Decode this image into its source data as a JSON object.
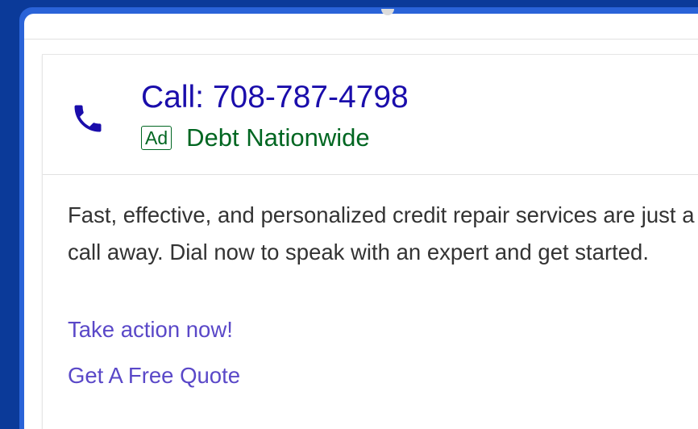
{
  "ad": {
    "phone_label": "Call: 708-787-4798",
    "badge": "Ad",
    "advertiser": "Debt Nationwide",
    "description": "Fast, effective, and personalized credit repair services are just a call away. Dial now to speak with an expert and get started.",
    "links": [
      {
        "label": "Take action now!"
      },
      {
        "label": "Get A Free Quote"
      }
    ],
    "icon": "phone-icon"
  },
  "colors": {
    "background": "#0b3a99",
    "frame": "#2a63d8",
    "title_link": "#1a0dab",
    "ad_green": "#006621",
    "body_text": "#333333",
    "sitelink": "#5a48c8"
  }
}
